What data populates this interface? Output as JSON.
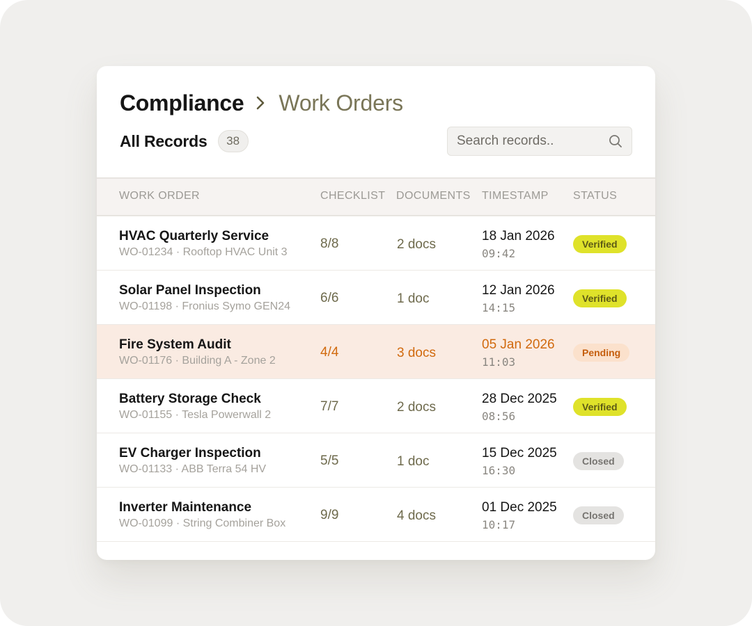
{
  "breadcrumb": {
    "root": "Compliance",
    "current": "Work Orders"
  },
  "records": {
    "title": "All Records",
    "count": "38"
  },
  "search": {
    "placeholder": "Search records.."
  },
  "table": {
    "columns": [
      "WORK ORDER",
      "CHECKLIST",
      "DOCUMENTS",
      "TIMESTAMP",
      "STATUS"
    ],
    "rows": [
      {
        "title": "HVAC Quarterly Service",
        "subtitle": "WO-01234 · Rooftop HVAC Unit 3",
        "checklist": "8/8",
        "documents": "2 docs",
        "date": "18 Jan 2026",
        "time": "09:42",
        "status": "Verified",
        "status_type": "verified"
      },
      {
        "title": "Solar Panel Inspection",
        "subtitle": "WO-01198 · Fronius Symo GEN24",
        "checklist": "6/6",
        "documents": "1 doc",
        "date": "12 Jan 2026",
        "time": "14:15",
        "status": "Verified",
        "status_type": "verified"
      },
      {
        "title": "Fire System Audit",
        "subtitle": "WO-01176 · Building A - Zone 2",
        "checklist": "4/4",
        "documents": "3 docs",
        "date": "05 Jan 2026",
        "time": "11:03",
        "status": "Pending",
        "status_type": "pending"
      },
      {
        "title": "Battery Storage Check",
        "subtitle": "WO-01155 · Tesla Powerwall 2",
        "checklist": "7/7",
        "documents": "2 docs",
        "date": "28 Dec 2025",
        "time": "08:56",
        "status": "Verified",
        "status_type": "verified"
      },
      {
        "title": "EV Charger Inspection",
        "subtitle": "WO-01133 · ABB Terra 54 HV",
        "checklist": "5/5",
        "documents": "1 doc",
        "date": "15 Dec 2025",
        "time": "16:30",
        "status": "Closed",
        "status_type": "closed"
      },
      {
        "title": "Inverter Maintenance",
        "subtitle": "WO-01099 · String Combiner Box",
        "checklist": "9/9",
        "documents": "4 docs",
        "date": "01 Dec 2025",
        "time": "10:17",
        "status": "Closed",
        "status_type": "closed"
      }
    ]
  },
  "colors": {
    "verified": "#dfe22a",
    "pending": "#d16a0e",
    "closed": "#e4e3e1",
    "accent_olive": "#7a7658"
  },
  "icons": {
    "separator": "chevron-right-icon",
    "search": "search-icon"
  }
}
